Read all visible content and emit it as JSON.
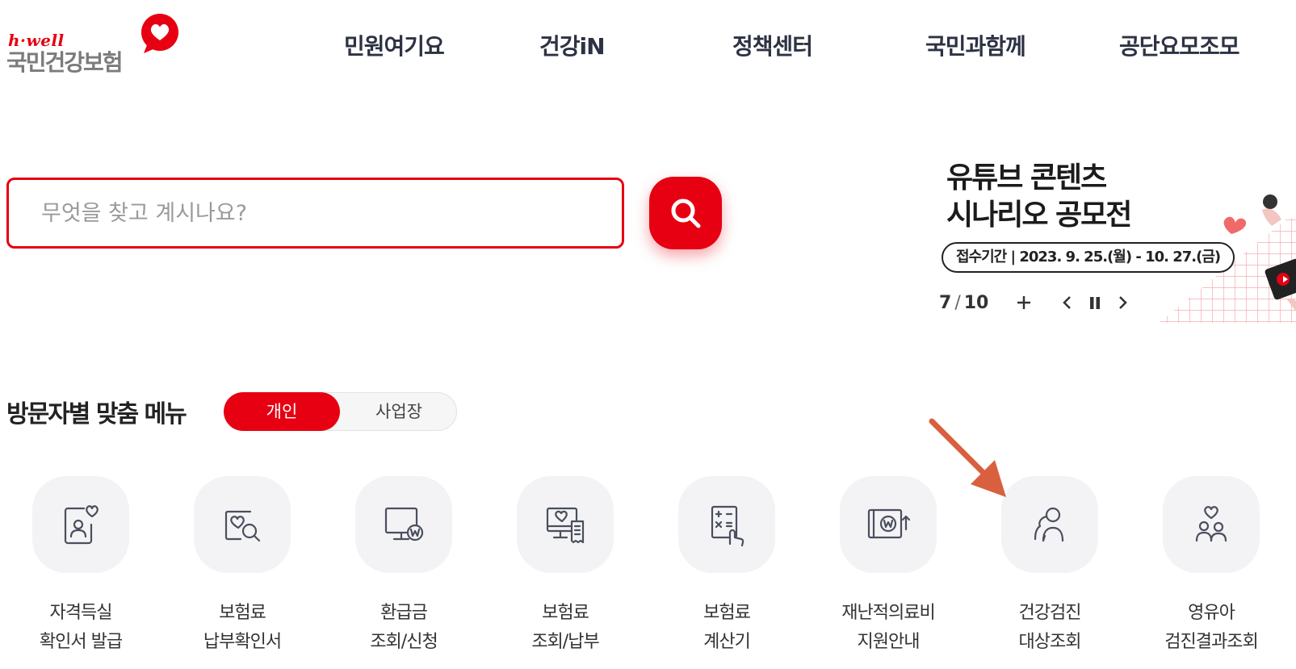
{
  "logo": {
    "tagline": "h·well",
    "name": "국민건강보험"
  },
  "nav": {
    "items": [
      "민원여기요",
      "건강iN",
      "정책센터",
      "국민과함께",
      "공단요모조모"
    ]
  },
  "search": {
    "placeholder": "무엇을 찾고 계시나요?"
  },
  "banner": {
    "title_line1": "유튜브 콘텐츠",
    "title_line2": "시나리오 공모전",
    "period": "접수기간 | 2023. 9. 25.(월) - 10. 27.(금)",
    "current": "7",
    "total": "10",
    "separator": "/"
  },
  "visitor_menu": {
    "title": "방문자별 맞춤 메뉴",
    "tab_personal": "개인",
    "tab_business": "사업장"
  },
  "quick_menu": [
    {
      "line1": "자격득실",
      "line2": "확인서 발급",
      "icon": "id-card-heart-icon"
    },
    {
      "line1": "보험료",
      "line2": "납부확인서",
      "icon": "document-search-icon"
    },
    {
      "line1": "환급금",
      "line2": "조회/신청",
      "icon": "monitor-won-icon"
    },
    {
      "line1": "보험료",
      "line2": "조회/납부",
      "icon": "monitor-receipt-icon"
    },
    {
      "line1": "보험료",
      "line2": "계산기",
      "icon": "calculator-hand-icon"
    },
    {
      "line1": "재난적의료비",
      "line2": "지원안내",
      "icon": "wallet-won-icon"
    },
    {
      "line1": "건강검진",
      "line2": "대상조회",
      "icon": "people-checkup-icon"
    },
    {
      "line1": "영유아",
      "line2": "검진결과조회",
      "icon": "family-heart-icon"
    }
  ],
  "colors": {
    "brand_red": "#e60012",
    "nav_text": "#2d3243",
    "annotation_arrow": "#d9603f"
  }
}
